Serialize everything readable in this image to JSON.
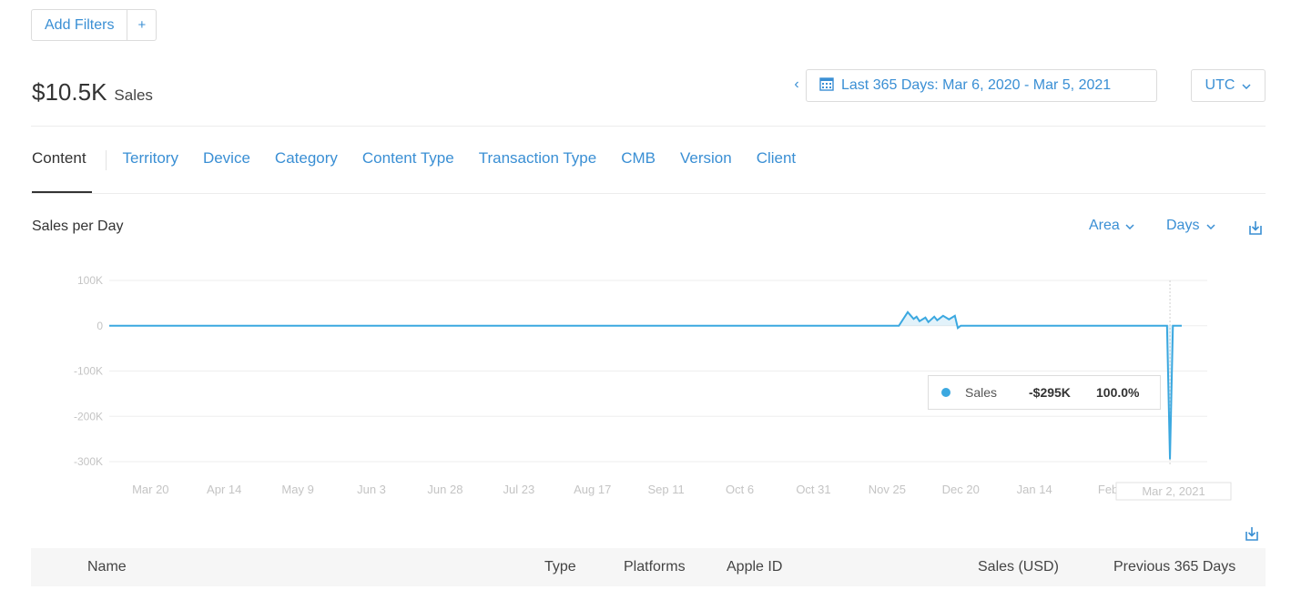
{
  "filters": {
    "add_label": "Add Filters",
    "plus_label": "+"
  },
  "summary": {
    "value": "$10.5K",
    "label": "Sales"
  },
  "date_range": {
    "prev_label": "‹",
    "label": "Last 365 Days: Mar 6, 2020 - Mar 5, 2021",
    "icon": "calendar-icon"
  },
  "timezone": {
    "value": "UTC"
  },
  "tabs": [
    {
      "label": "Content",
      "active": true
    },
    {
      "label": "Territory"
    },
    {
      "label": "Device"
    },
    {
      "label": "Category"
    },
    {
      "label": "Content Type"
    },
    {
      "label": "Transaction Type"
    },
    {
      "label": "CMB"
    },
    {
      "label": "Version"
    },
    {
      "label": "Client"
    }
  ],
  "chart": {
    "title": "Sales per Day",
    "type_select": "Area",
    "granularity_select": "Days",
    "accent": "#3ba8e0",
    "tooltip": {
      "series": "Sales",
      "value": "-$295K",
      "percent": "100.0%"
    }
  },
  "chart_data": {
    "type": "area",
    "title": "Sales per Day",
    "ylim": [
      -300000,
      100000
    ],
    "y_ticks": [
      "100K",
      "0",
      "-100K",
      "-200K",
      "-300K"
    ],
    "x_ticks": [
      "Mar 20",
      "Apr 14",
      "May 9",
      "Jun 3",
      "Jun 28",
      "Jul 23",
      "Aug 17",
      "Sep 11",
      "Oct 6",
      "Oct 31",
      "Nov 25",
      "Dec 20",
      "Jan 14",
      "Feb"
    ],
    "hover_label": "Mar 2, 2021",
    "series": [
      {
        "name": "Sales",
        "color": "#3ba8e0",
        "points": [
          [
            "2020-03-06",
            0
          ],
          [
            "2020-11-29",
            0
          ],
          [
            "2020-12-02",
            30000
          ],
          [
            "2020-12-04",
            15000
          ],
          [
            "2020-12-05",
            20000
          ],
          [
            "2020-12-06",
            10000
          ],
          [
            "2020-12-08",
            18000
          ],
          [
            "2020-12-09",
            8000
          ],
          [
            "2020-12-11",
            20000
          ],
          [
            "2020-12-12",
            12000
          ],
          [
            "2020-12-14",
            22000
          ],
          [
            "2020-12-16",
            14000
          ],
          [
            "2020-12-18",
            22000
          ],
          [
            "2020-12-19",
            -5000
          ],
          [
            "2020-12-20",
            0
          ],
          [
            "2021-02-28",
            0
          ],
          [
            "2021-03-01",
            -295000
          ],
          [
            "2021-03-02",
            0
          ],
          [
            "2021-03-05",
            0
          ]
        ]
      }
    ]
  },
  "table": {
    "columns": [
      "Name",
      "Type",
      "Platforms",
      "Apple ID",
      "Sales (USD)",
      "Previous 365 Days"
    ]
  }
}
